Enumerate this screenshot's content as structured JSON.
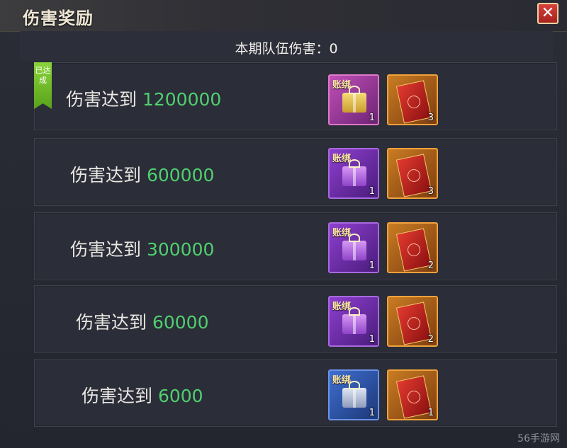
{
  "window": {
    "title": "伤害奖励",
    "close_label": "✕"
  },
  "header": {
    "text": "本期队伍伤害：0"
  },
  "rows": [
    {
      "prefix": "伤害达到 ",
      "value": "1200000",
      "badge": "已达成",
      "items": [
        {
          "tag": "账绑",
          "icon": "gift-box-icon",
          "color": "pink",
          "qty": "1"
        },
        {
          "tag": "",
          "icon": "red-ticket-icon",
          "color": "orange",
          "qty": "3"
        }
      ]
    },
    {
      "prefix": "伤害达到 ",
      "value": "600000",
      "items": [
        {
          "tag": "账绑",
          "icon": "gift-box-icon",
          "color": "purple",
          "qty": "1"
        },
        {
          "tag": "",
          "icon": "red-ticket-icon",
          "color": "orange",
          "qty": "3"
        }
      ]
    },
    {
      "prefix": "伤害达到 ",
      "value": "300000",
      "items": [
        {
          "tag": "账绑",
          "icon": "gift-box-icon",
          "color": "purple",
          "qty": "1"
        },
        {
          "tag": "",
          "icon": "red-ticket-icon",
          "color": "orange",
          "qty": "2"
        }
      ]
    },
    {
      "prefix": "伤害达到 ",
      "value": "60000",
      "items": [
        {
          "tag": "账绑",
          "icon": "gift-box-icon",
          "color": "purple",
          "qty": "1"
        },
        {
          "tag": "",
          "icon": "red-ticket-icon",
          "color": "orange",
          "qty": "2"
        }
      ]
    },
    {
      "prefix": "伤害达到 ",
      "value": "6000",
      "items": [
        {
          "tag": "账绑",
          "icon": "gift-box-icon",
          "color": "blue",
          "qty": "1"
        },
        {
          "tag": "",
          "icon": "red-ticket-icon",
          "color": "orange",
          "qty": "1"
        }
      ]
    }
  ],
  "watermark": "56手游网",
  "colors": {
    "value_green": "#4fd06f",
    "badge_green": "#6fbf2a",
    "close_red": "#c8322d"
  }
}
